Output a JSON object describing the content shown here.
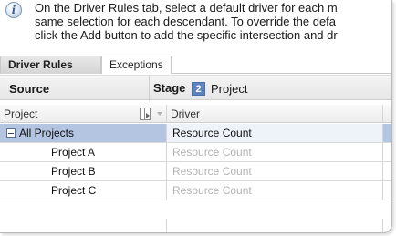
{
  "info": {
    "icon": "info-icon",
    "lines": [
      "On the Driver Rules tab, select a default driver for each m",
      "same selection for each descendant. To override the defa",
      "click the Add button to add the specific intersection and dr"
    ]
  },
  "tabs": [
    {
      "label": "Driver Rules",
      "active": true
    },
    {
      "label": "Exceptions",
      "active": false
    }
  ],
  "header": {
    "source_label": "Source",
    "stage_label": "Stage",
    "stage_number": "2",
    "stage_value": "Project"
  },
  "grid": {
    "columns": [
      "Project",
      "Driver"
    ],
    "rows": [
      {
        "project": "All Projects",
        "driver": "Resource Count",
        "selected": true,
        "expanded": true
      },
      {
        "project": "Project A",
        "driver": "Resource Count",
        "selected": false
      },
      {
        "project": "Project B",
        "driver": "Resource Count",
        "selected": false
      },
      {
        "project": "Project C",
        "driver": "Resource Count",
        "selected": false
      }
    ]
  },
  "colors": {
    "selected_row": "#b4c5e2",
    "stage_badge": "#5e83c0",
    "inherited_text": "#b3b3b3"
  }
}
